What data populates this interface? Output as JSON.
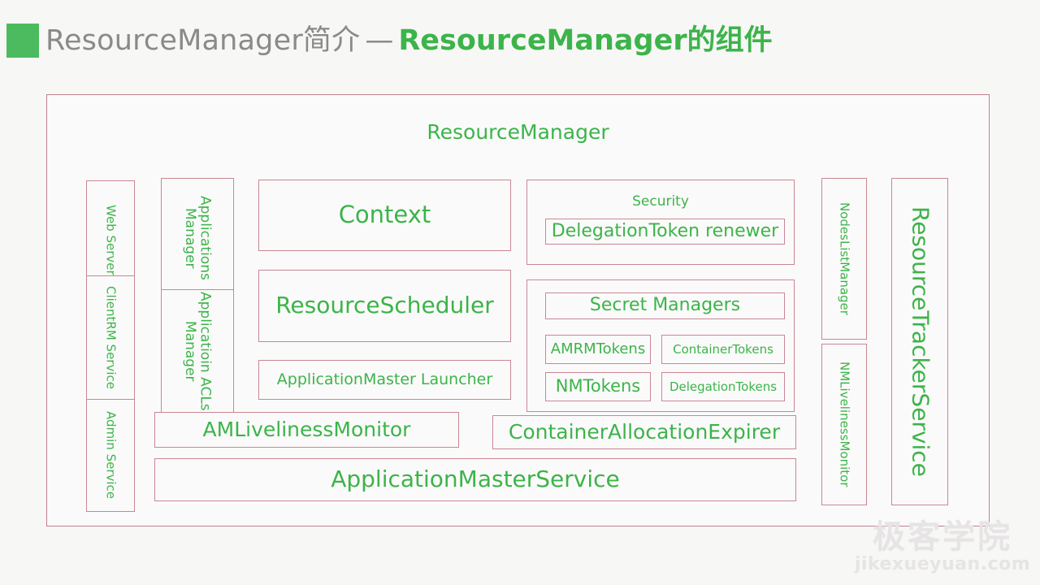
{
  "header": {
    "accent_color": "#4cbb5f",
    "title_plain": "ResourceManager简介",
    "title_dash": "—",
    "title_strong": "ResourceManager的组件"
  },
  "diagram": {
    "title": "ResourceManager",
    "border_color": "#c2808d",
    "text_color": "#3cb44a",
    "left_column": [
      {
        "label": "Web Server"
      },
      {
        "label": "ClientRM Service"
      },
      {
        "label": "Admin Service"
      }
    ],
    "managers_column": [
      {
        "label": "Applications Manager"
      },
      {
        "label": "Applicatioin ACLs Manager"
      }
    ],
    "center_column": [
      {
        "label": "Context"
      },
      {
        "label": "ResourceScheduler"
      },
      {
        "label": "ApplicationMaster Launcher"
      }
    ],
    "security": {
      "label": "Security",
      "items": [
        {
          "label": "DelegationToken renewer"
        }
      ]
    },
    "secret_managers": {
      "label": "Secret Managers",
      "items": [
        {
          "label": "AMRMTokens"
        },
        {
          "label": "ContainerTokens"
        },
        {
          "label": "NMTokens"
        },
        {
          "label": "DelegationTokens"
        }
      ]
    },
    "bottom_row": [
      {
        "label": "AMLivelinessMonitor"
      },
      {
        "label": "ContainerAllocationExpirer"
      },
      {
        "label": "ApplicationMasterService"
      }
    ],
    "right_column": [
      {
        "label": "NodesListManager"
      },
      {
        "label": "NMLivelinessMonitor"
      },
      {
        "label": "ResourceTrackerService"
      }
    ]
  },
  "watermark": {
    "cn": "极客学院",
    "en": "jikexueyuan.com"
  }
}
